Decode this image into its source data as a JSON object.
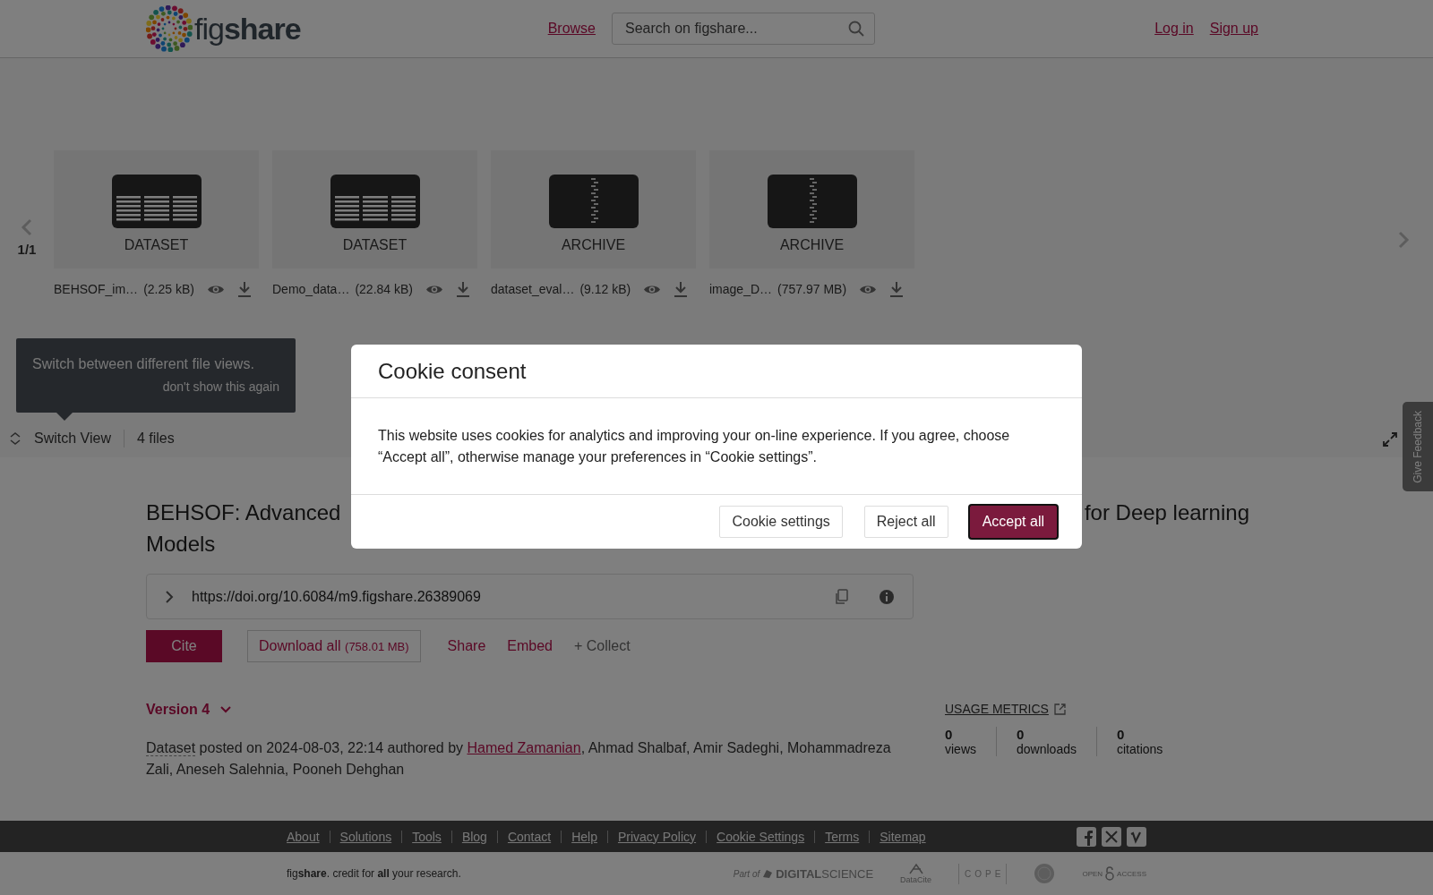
{
  "header": {
    "logo_text": "fig**share**",
    "nav_link": "Browse",
    "search": {
      "placeholder": "Search on figshare..."
    },
    "auth_links": [
      "Log in",
      "Sign up"
    ]
  },
  "file_viewer": {
    "page_indicator": "1/1",
    "files": [
      {
        "kind": "dataset",
        "type_label": "DATASET",
        "name": "BEHSOF_im…",
        "size": "(2.25 kB)"
      },
      {
        "kind": "dataset",
        "type_label": "DATASET",
        "name": "Demo_data…",
        "size": "(22.84 kB)"
      },
      {
        "kind": "archive",
        "type_label": "ARCHIVE",
        "name": "dataset_eval…",
        "size": "(9.12 kB)"
      },
      {
        "kind": "archive",
        "type_label": "ARCHIVE",
        "name": "image_D…",
        "size": "(757.97 MB)"
      }
    ],
    "tooltip": {
      "text": "Switch between different file views.",
      "dismiss": "don't show this again"
    },
    "switch_view": "Switch View",
    "file_count": "4 files"
  },
  "article": {
    "title_parts": [
      "BEHSOF: Advanced",
      "for Deep learning",
      "Models"
    ],
    "doi": "https://doi.org/10.6084/m9.figshare.26389069",
    "actions": [
      {
        "kind": "primary",
        "label": "Cite"
      },
      {
        "kind": "outline",
        "label": "Download all",
        "note": "(758.01 MB)"
      },
      {
        "kind": "link",
        "label": "Share"
      },
      {
        "kind": "link",
        "label": "Embed"
      },
      {
        "kind": "muted",
        "label": "+ Collect"
      }
    ],
    "version": "Version 4",
    "byline": {
      "item_type": "Dataset",
      "posted": " posted on 2024-08-03, 22:14 authored by ",
      "lead_author": "Hamed Zamanian",
      "other_authors": ", Ahmad Shalbaf, Amir Sadeghi, Mohammadreza Zali, Aneseh Salehnia, Pooneh Dehghan"
    },
    "usage_metrics": {
      "title": "USAGE METRICS",
      "items": [
        {
          "value": "0",
          "label": "views"
        },
        {
          "value": "0",
          "label": "downloads"
        },
        {
          "value": "0",
          "label": "citations"
        }
      ]
    }
  },
  "footer": {
    "links": [
      "About",
      "Solutions",
      "Tools",
      "Blog",
      "Contact",
      "Help",
      "Privacy Policy",
      "Cookie Settings",
      "Terms",
      "Sitemap"
    ],
    "tagline": "fig**share**. credit for **all** your research.",
    "partners": [
      {
        "kind": "digital-science",
        "label": "Part of",
        "name": "**DIGITAL**SCIENCE"
      },
      {
        "kind": "datacite",
        "name": "DataCite"
      },
      {
        "kind": "cope",
        "name": "COPE"
      },
      {
        "kind": "seal"
      },
      {
        "kind": "open-access",
        "name": "OPEN",
        "name_2": "ACCESS"
      }
    ]
  },
  "feedback_tab": "Give Feedback",
  "cookie_modal": {
    "title": "Cookie consent",
    "body": "This website uses cookies for analytics and improving your on-line experience. If you agree, choose “Accept all”, otherwise manage your preferences in “Cookie settings”.",
    "buttons": [
      {
        "kind": "secondary",
        "label": "Cookie settings",
        "focused": false
      },
      {
        "kind": "secondary",
        "label": "Reject all",
        "focused": false
      },
      {
        "kind": "primary",
        "label": "Accept all",
        "focused": true
      }
    ]
  }
}
